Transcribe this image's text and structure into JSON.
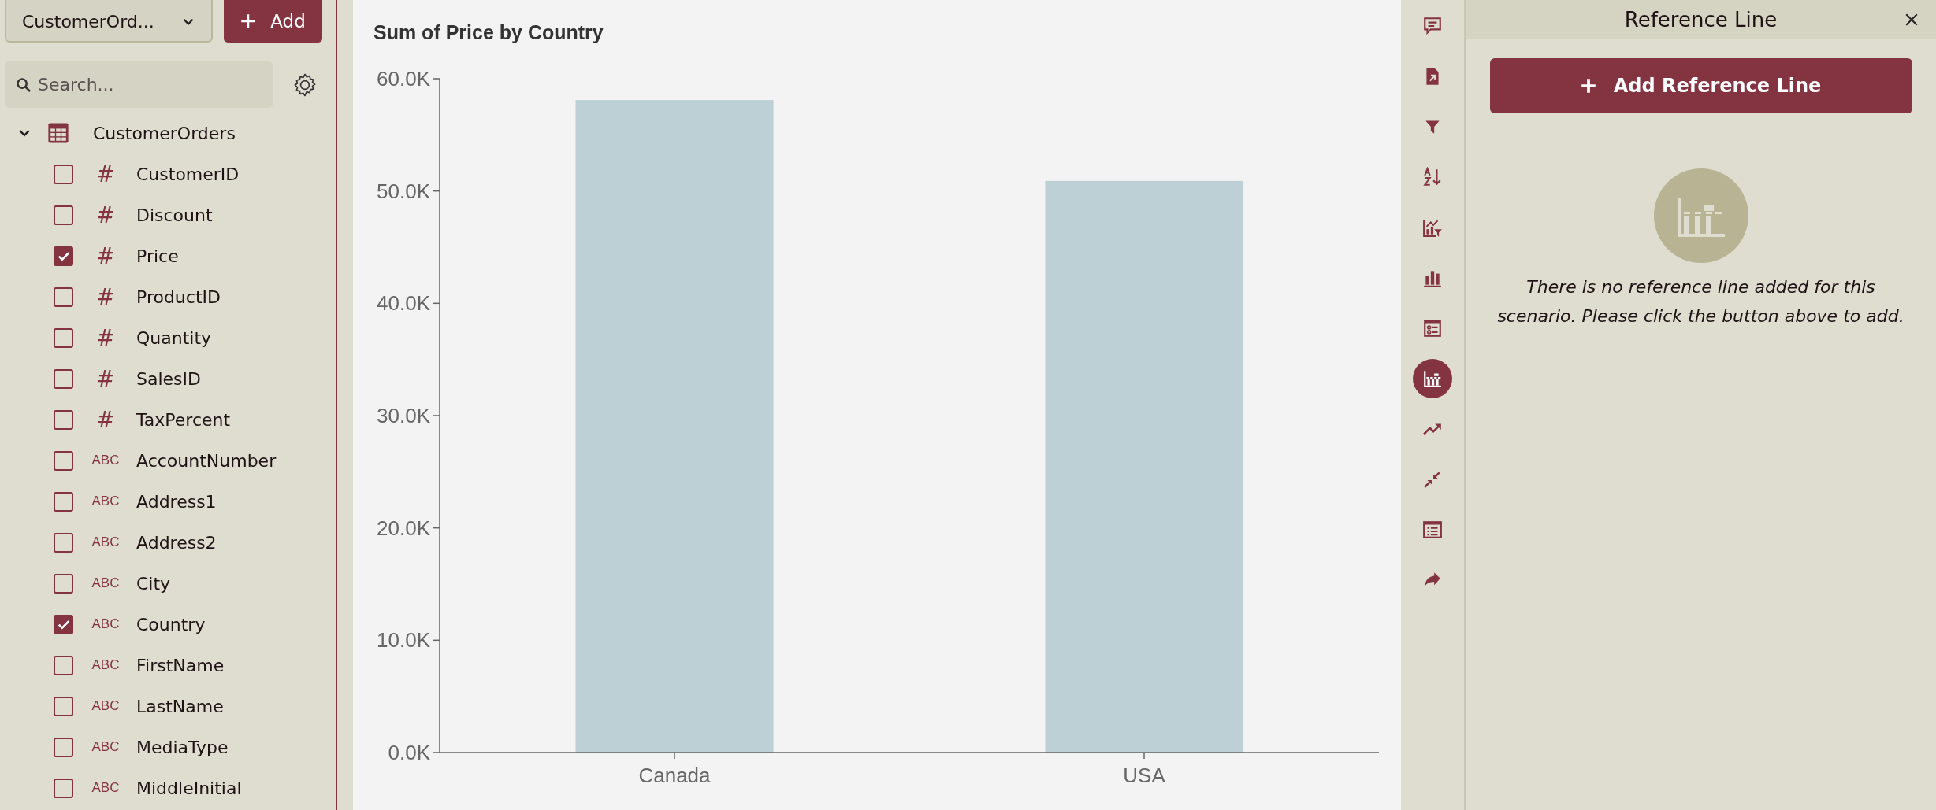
{
  "sidebar": {
    "source_dropdown": {
      "value": "CustomerOrd..."
    },
    "add_button": {
      "label": "Add"
    },
    "search": {
      "placeholder": "Search..."
    },
    "tree": [
      {
        "label": "CustomerOrders",
        "expanded": true,
        "children": [
          {
            "label": "CustomerID",
            "kind": "number",
            "type_label": "#",
            "checked": false
          },
          {
            "label": "Discount",
            "kind": "number",
            "type_label": "#",
            "checked": false
          },
          {
            "label": "Price",
            "kind": "number",
            "type_label": "#",
            "checked": true
          },
          {
            "label": "ProductID",
            "kind": "number",
            "type_label": "#",
            "checked": false
          },
          {
            "label": "Quantity",
            "kind": "number",
            "type_label": "#",
            "checked": false
          },
          {
            "label": "SalesID",
            "kind": "number",
            "type_label": "#",
            "checked": false
          },
          {
            "label": "TaxPercent",
            "kind": "number",
            "type_label": "#",
            "checked": false
          },
          {
            "label": "AccountNumber",
            "kind": "text",
            "type_label": "ABC",
            "checked": false
          },
          {
            "label": "Address1",
            "kind": "text",
            "type_label": "ABC",
            "checked": false
          },
          {
            "label": "Address2",
            "kind": "text",
            "type_label": "ABC",
            "checked": false
          },
          {
            "label": "City",
            "kind": "text",
            "type_label": "ABC",
            "checked": false
          },
          {
            "label": "Country",
            "kind": "text",
            "type_label": "ABC",
            "checked": true
          },
          {
            "label": "FirstName",
            "kind": "text",
            "type_label": "ABC",
            "checked": false
          },
          {
            "label": "LastName",
            "kind": "text",
            "type_label": "ABC",
            "checked": false
          },
          {
            "label": "MediaType",
            "kind": "text",
            "type_label": "ABC",
            "checked": false
          },
          {
            "label": "MiddleInitial",
            "kind": "text",
            "type_label": "ABC",
            "checked": false
          }
        ]
      }
    ]
  },
  "chart": {
    "chart_data": {
      "type": "bar",
      "title": "Sum of Price by Country",
      "categories": [
        "Canada",
        "USA"
      ],
      "series": [
        {
          "color": "#bcd0d5",
          "values": [
            58100,
            50900
          ]
        }
      ],
      "ylim": [
        0,
        60000
      ],
      "yticks": [
        {
          "value": 0,
          "label": "0.0K"
        },
        {
          "value": 10000,
          "label": "10.0K"
        },
        {
          "value": 20000,
          "label": "20.0K"
        },
        {
          "value": 30000,
          "label": "30.0K"
        },
        {
          "value": 40000,
          "label": "40.0K"
        },
        {
          "value": 50000,
          "label": "50.0K"
        },
        {
          "value": 60000,
          "label": "60.0K"
        }
      ]
    }
  },
  "toolbar": {
    "items": [
      {
        "kind": "comment",
        "selected": false
      },
      {
        "kind": "export",
        "selected": false
      },
      {
        "kind": "filter",
        "selected": false
      },
      {
        "kind": "sort",
        "selected": false
      },
      {
        "kind": "chart-filter",
        "selected": false
      },
      {
        "kind": "bar-chart",
        "selected": false
      },
      {
        "kind": "form",
        "selected": false
      },
      {
        "kind": "reference-line",
        "selected": true
      },
      {
        "kind": "trend",
        "selected": false
      },
      {
        "kind": "collapse",
        "selected": false
      },
      {
        "kind": "list",
        "selected": false
      },
      {
        "kind": "share",
        "selected": false
      }
    ]
  },
  "panel": {
    "title": "Reference Line",
    "add_button": {
      "label": "Add Reference Line"
    },
    "empty_message": "There is no reference line added for this scenario. Please click the button above to add."
  }
}
